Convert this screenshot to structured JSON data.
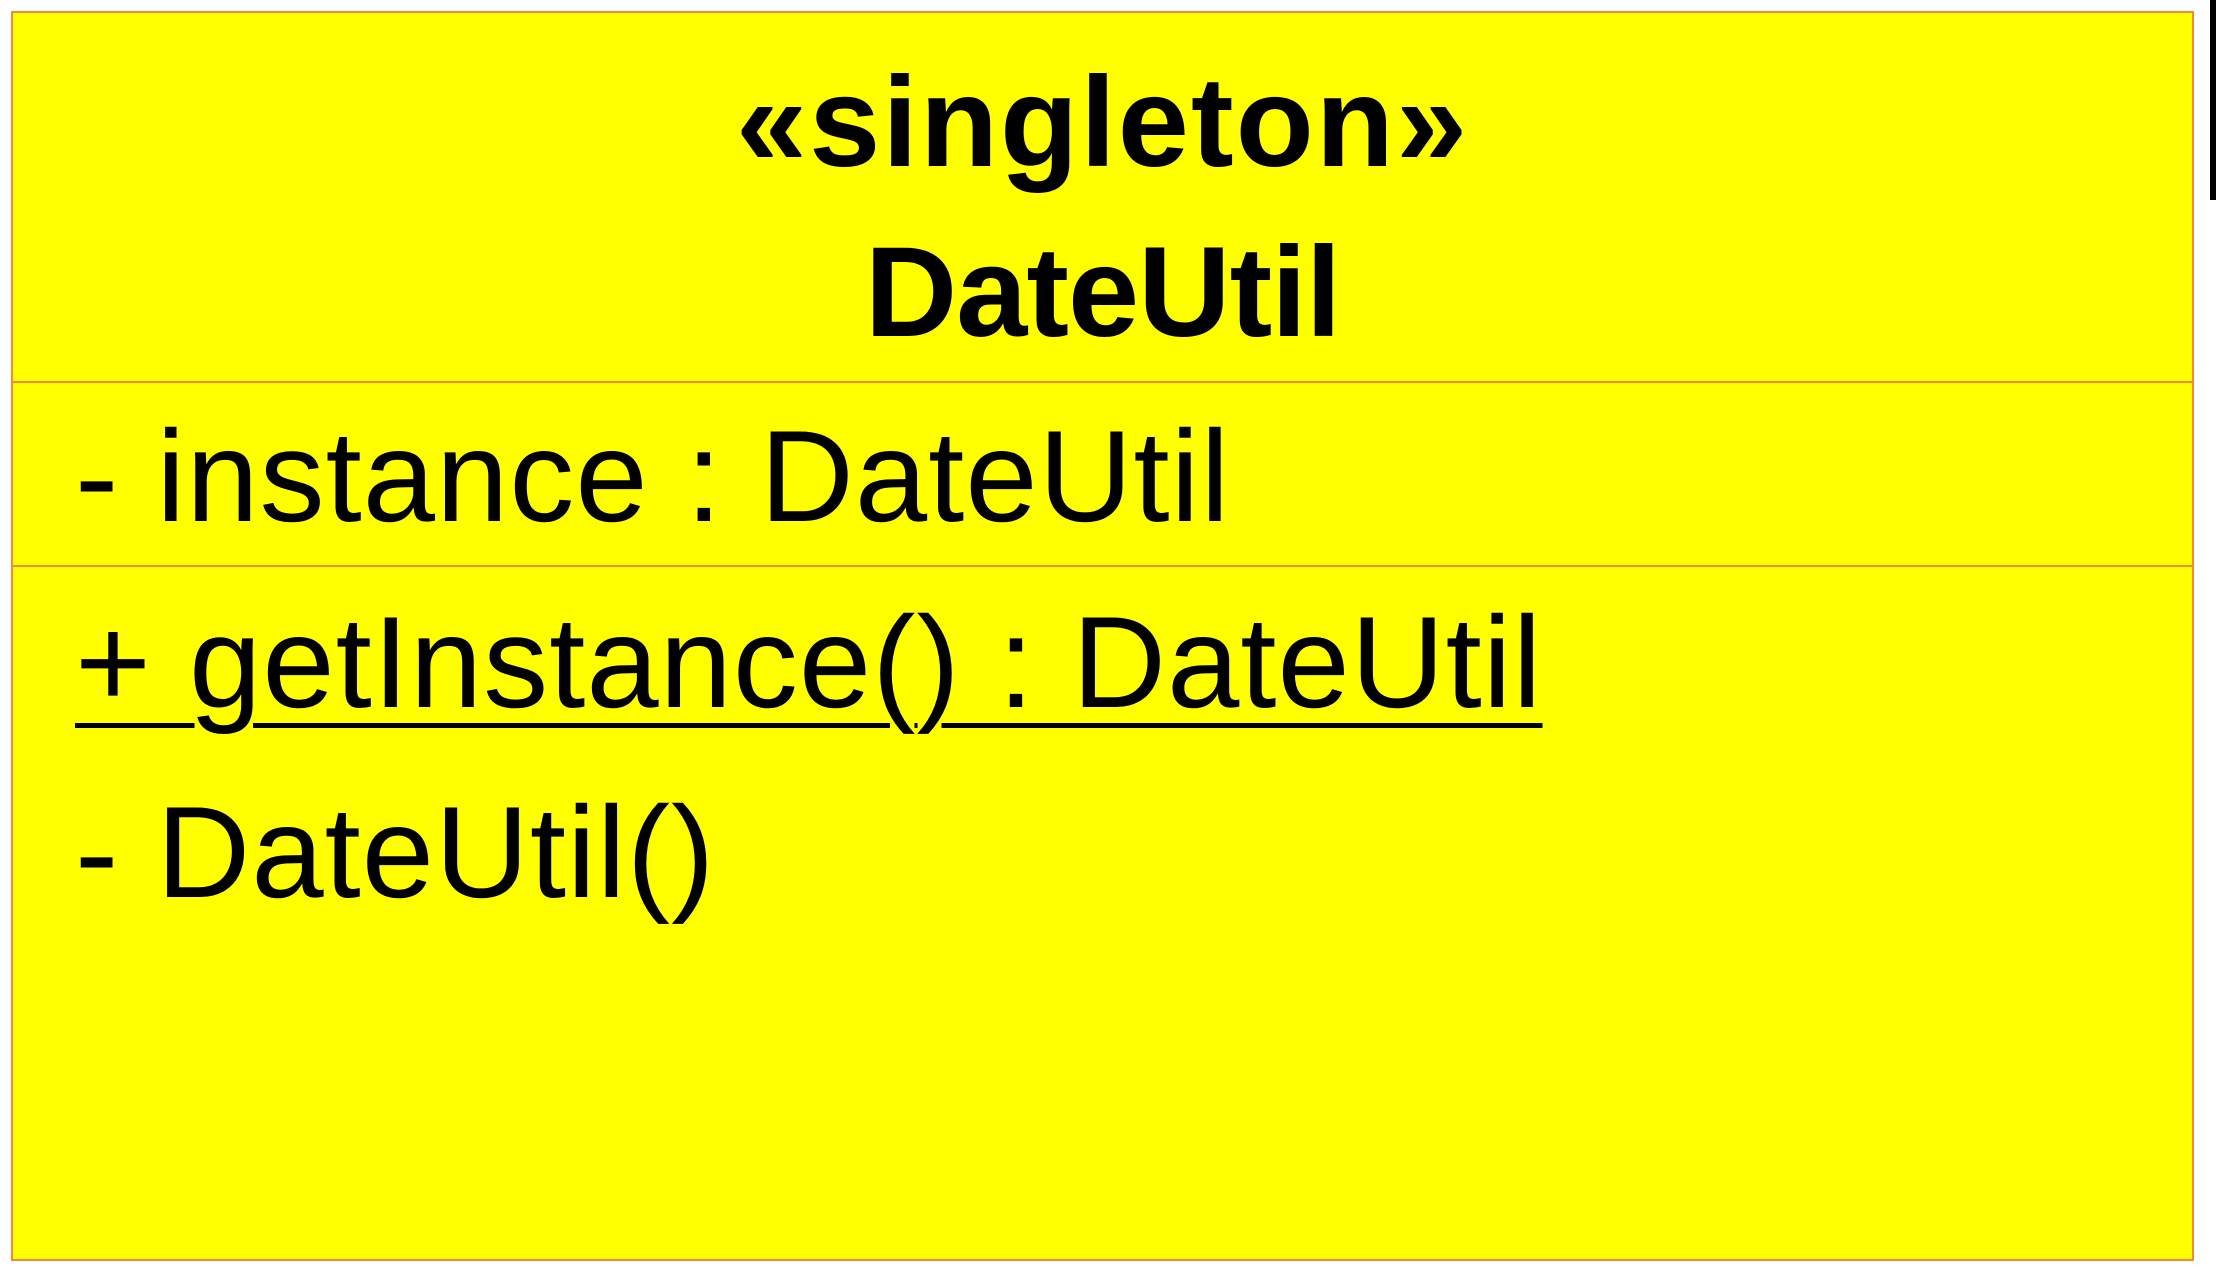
{
  "diagram": {
    "type": "uml-class",
    "colors": {
      "fill": "#ffff00",
      "border": "#f28a3b",
      "text": "#000000"
    },
    "class": {
      "stereotype": "«singleton»",
      "name": "DateUtil",
      "attributes": [
        {
          "text": "- instance : DateUtil",
          "visibility": "private",
          "static": false
        }
      ],
      "operations": [
        {
          "text": "+ getInstance() : DateUtil",
          "visibility": "public",
          "static": true
        },
        {
          "text": "- DateUtil()",
          "visibility": "private",
          "static": false
        }
      ]
    }
  }
}
